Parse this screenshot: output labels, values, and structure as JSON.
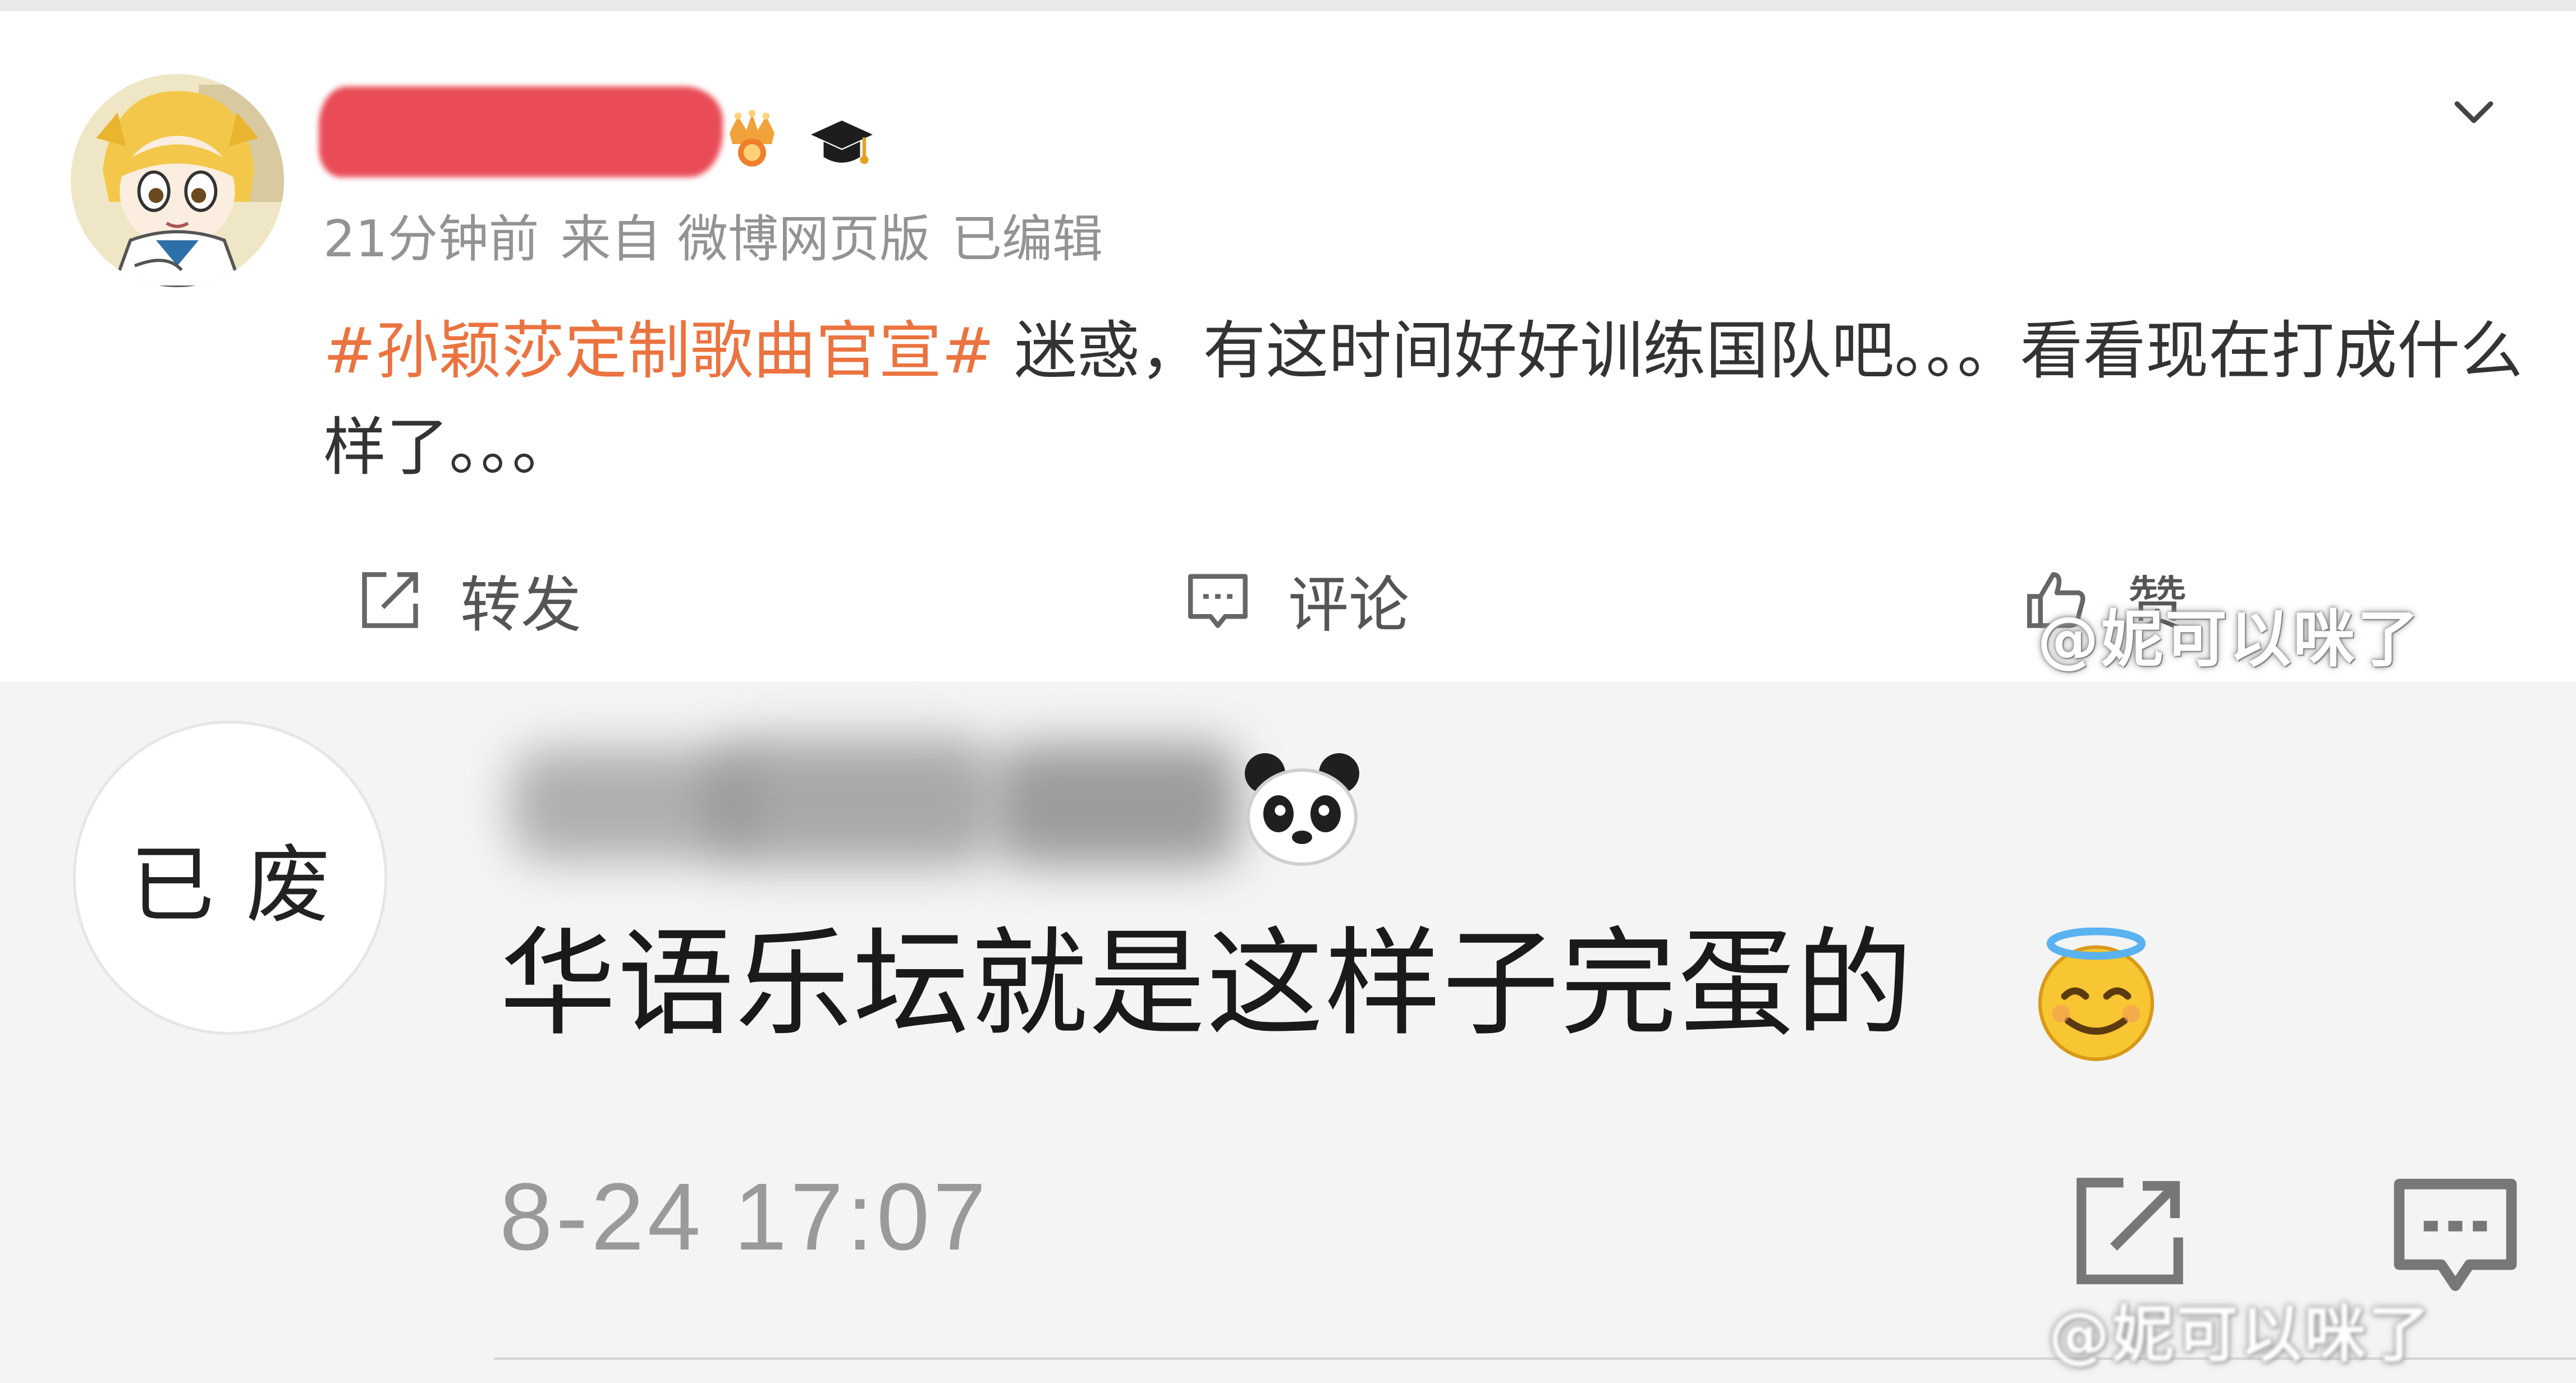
{
  "post": {
    "timestamp": "21分钟前",
    "source": "来自 微博网页版",
    "edited": "已编辑",
    "hashtag": "#孙颖莎定制歌曲官宣#",
    "text": "迷惑，有这时间好好训练国队吧。。。看看现在打成什么样了。。。",
    "actions": {
      "repost_label": "转发",
      "comment_label": "评论",
      "like_label": "赞"
    },
    "icons": [
      "crown-badge-icon",
      "graduation-cap-icon",
      "chevron-down-icon",
      "repost-icon",
      "comment-icon",
      "like-icon"
    ]
  },
  "watermark": "@妮可以咪了",
  "comment": {
    "avatar_text": "已废",
    "text": "华语乐坛就是这样子完蛋的",
    "date": "8-24 17:07",
    "icons": [
      "panda-emoji-icon",
      "halo-smile-emoji-icon",
      "share-icon",
      "comment-icon"
    ]
  },
  "colors": {
    "hashtag": "#eb7340",
    "text": "#333333",
    "meta": "#939393",
    "redaction": "#e8434d"
  }
}
